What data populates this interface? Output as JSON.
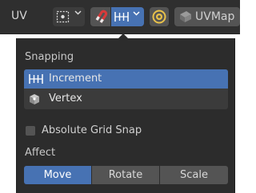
{
  "header": {
    "mode_label": "UV",
    "uv_map_name": "UVMap"
  },
  "icons": {
    "pivot": "pivot-point-icon",
    "snap_toggle": "magnet-icon",
    "snap_increment": "increment-icon",
    "sync": "selection-sync-icon",
    "uv_map": "uv-map-icon",
    "vertex": "vertex-cube-icon"
  },
  "popover": {
    "snapping_title": "Snapping",
    "snap_targets": [
      {
        "label": "Increment",
        "selected": true
      },
      {
        "label": "Vertex",
        "selected": false
      }
    ],
    "absolute_grid_snap": {
      "label": "Absolute Grid Snap",
      "checked": false
    },
    "affect_title": "Affect",
    "affect_options": [
      {
        "label": "Move",
        "active": true
      },
      {
        "label": "Rotate",
        "active": false
      },
      {
        "label": "Scale",
        "active": false
      }
    ]
  },
  "colors": {
    "accent": "#4772b3",
    "header_bg": "#2f2f2f",
    "panel_bg": "#2c2c2c",
    "button_bg": "#545454"
  }
}
